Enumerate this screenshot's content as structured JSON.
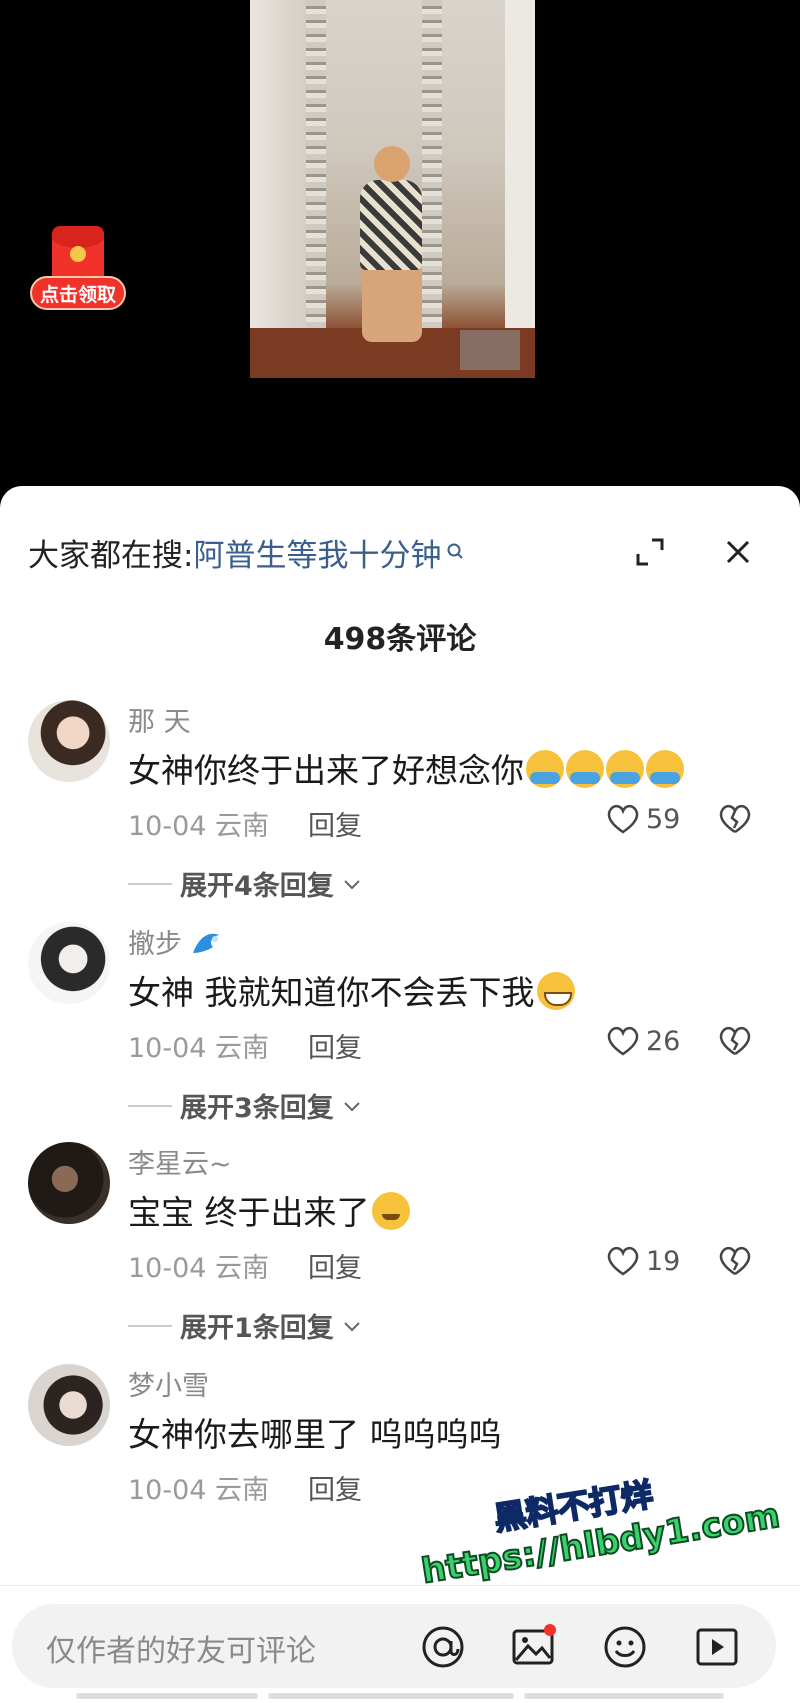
{
  "video": {
    "redpacket_label": "点击领取"
  },
  "sheet": {
    "search_prefix": "大家都在搜:",
    "search_term": "阿普生等我十分钟",
    "comment_count_title": "498条评论"
  },
  "comments": [
    {
      "name": "那 天",
      "text": "女神你终于出来了好想念你",
      "emoji": [
        "cry-emoji",
        "cry-emoji",
        "cry-emoji",
        "cry-emoji"
      ],
      "date": "10-04 云南",
      "reply": "回复",
      "likes": "59",
      "expand": "展开4条回复"
    },
    {
      "name": "撤步",
      "text": "女神 我就知道你不会丢下我",
      "emoji": [
        "grin-emoji"
      ],
      "date": "10-04 云南",
      "reply": "回复",
      "likes": "26",
      "expand": "展开3条回复"
    },
    {
      "name": "李星云~",
      "text": "宝宝 终于出来了",
      "emoji": [
        "smirk-emoji"
      ],
      "date": "10-04 云南",
      "reply": "回复",
      "likes": "19",
      "expand": "展开1条回复"
    },
    {
      "name": "梦小雪",
      "text": "女神你去哪里了 呜呜呜呜",
      "date": "10-04 云南",
      "reply": "回复"
    }
  ],
  "watermark": {
    "line1": "黑料不打烊",
    "line2": "https://hlbdy1.com"
  },
  "input": {
    "placeholder": "仅作者的好友可评论"
  },
  "colors": {
    "search_term": "#3a5f8f",
    "red": "#f0322b"
  }
}
